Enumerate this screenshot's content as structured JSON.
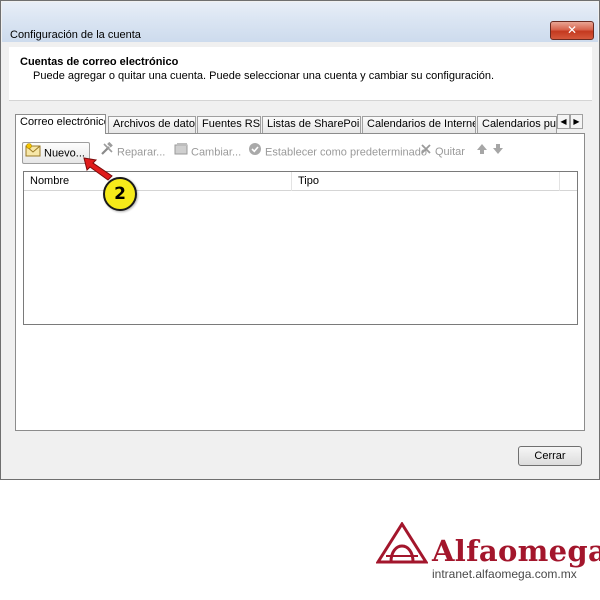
{
  "window": {
    "title": "Configuración de la cuenta",
    "close_symbol": "✕"
  },
  "header": {
    "title": "Cuentas de correo electrónico",
    "description": "Puede agregar o quitar una cuenta. Puede seleccionar una cuenta y cambiar su configuración."
  },
  "tabs": [
    {
      "label": "Correo electrónico",
      "active": true
    },
    {
      "label": "Archivos de datos",
      "active": false
    },
    {
      "label": "Fuentes RSS",
      "active": false
    },
    {
      "label": "Listas de SharePoint",
      "active": false
    },
    {
      "label": "Calendarios de Internet",
      "active": false
    },
    {
      "label": "Calendarios publi",
      "active": false
    }
  ],
  "tab_scroll": {
    "left": "◀",
    "right": "▶"
  },
  "toolbar": {
    "new_label": "Nuevo...",
    "repair_label": "Reparar...",
    "change_label": "Cambiar...",
    "set_default_label": "Establecer como predeterminado",
    "remove_label": "Quitar",
    "new_icon": "envelope-new-icon",
    "repair_icon": "wrench-hammer-icon",
    "change_icon": "edit-card-icon",
    "set_default_icon": "checkmark-circle-icon",
    "remove_icon": "x-icon",
    "move_up_icon": "arrow-up-icon",
    "move_down_icon": "arrow-down-icon"
  },
  "accounts_table": {
    "columns": [
      "Nombre",
      "Tipo"
    ],
    "rows": []
  },
  "footer": {
    "close_label": "Cerrar"
  },
  "annotation": {
    "step_number": "2",
    "arrow_color": "#e01c1c",
    "badge_color": "#f6ea1a"
  },
  "brand": {
    "name": "Alfaomega",
    "url": "intranet.alfaomega.com.mx",
    "color": "#a3162c"
  }
}
